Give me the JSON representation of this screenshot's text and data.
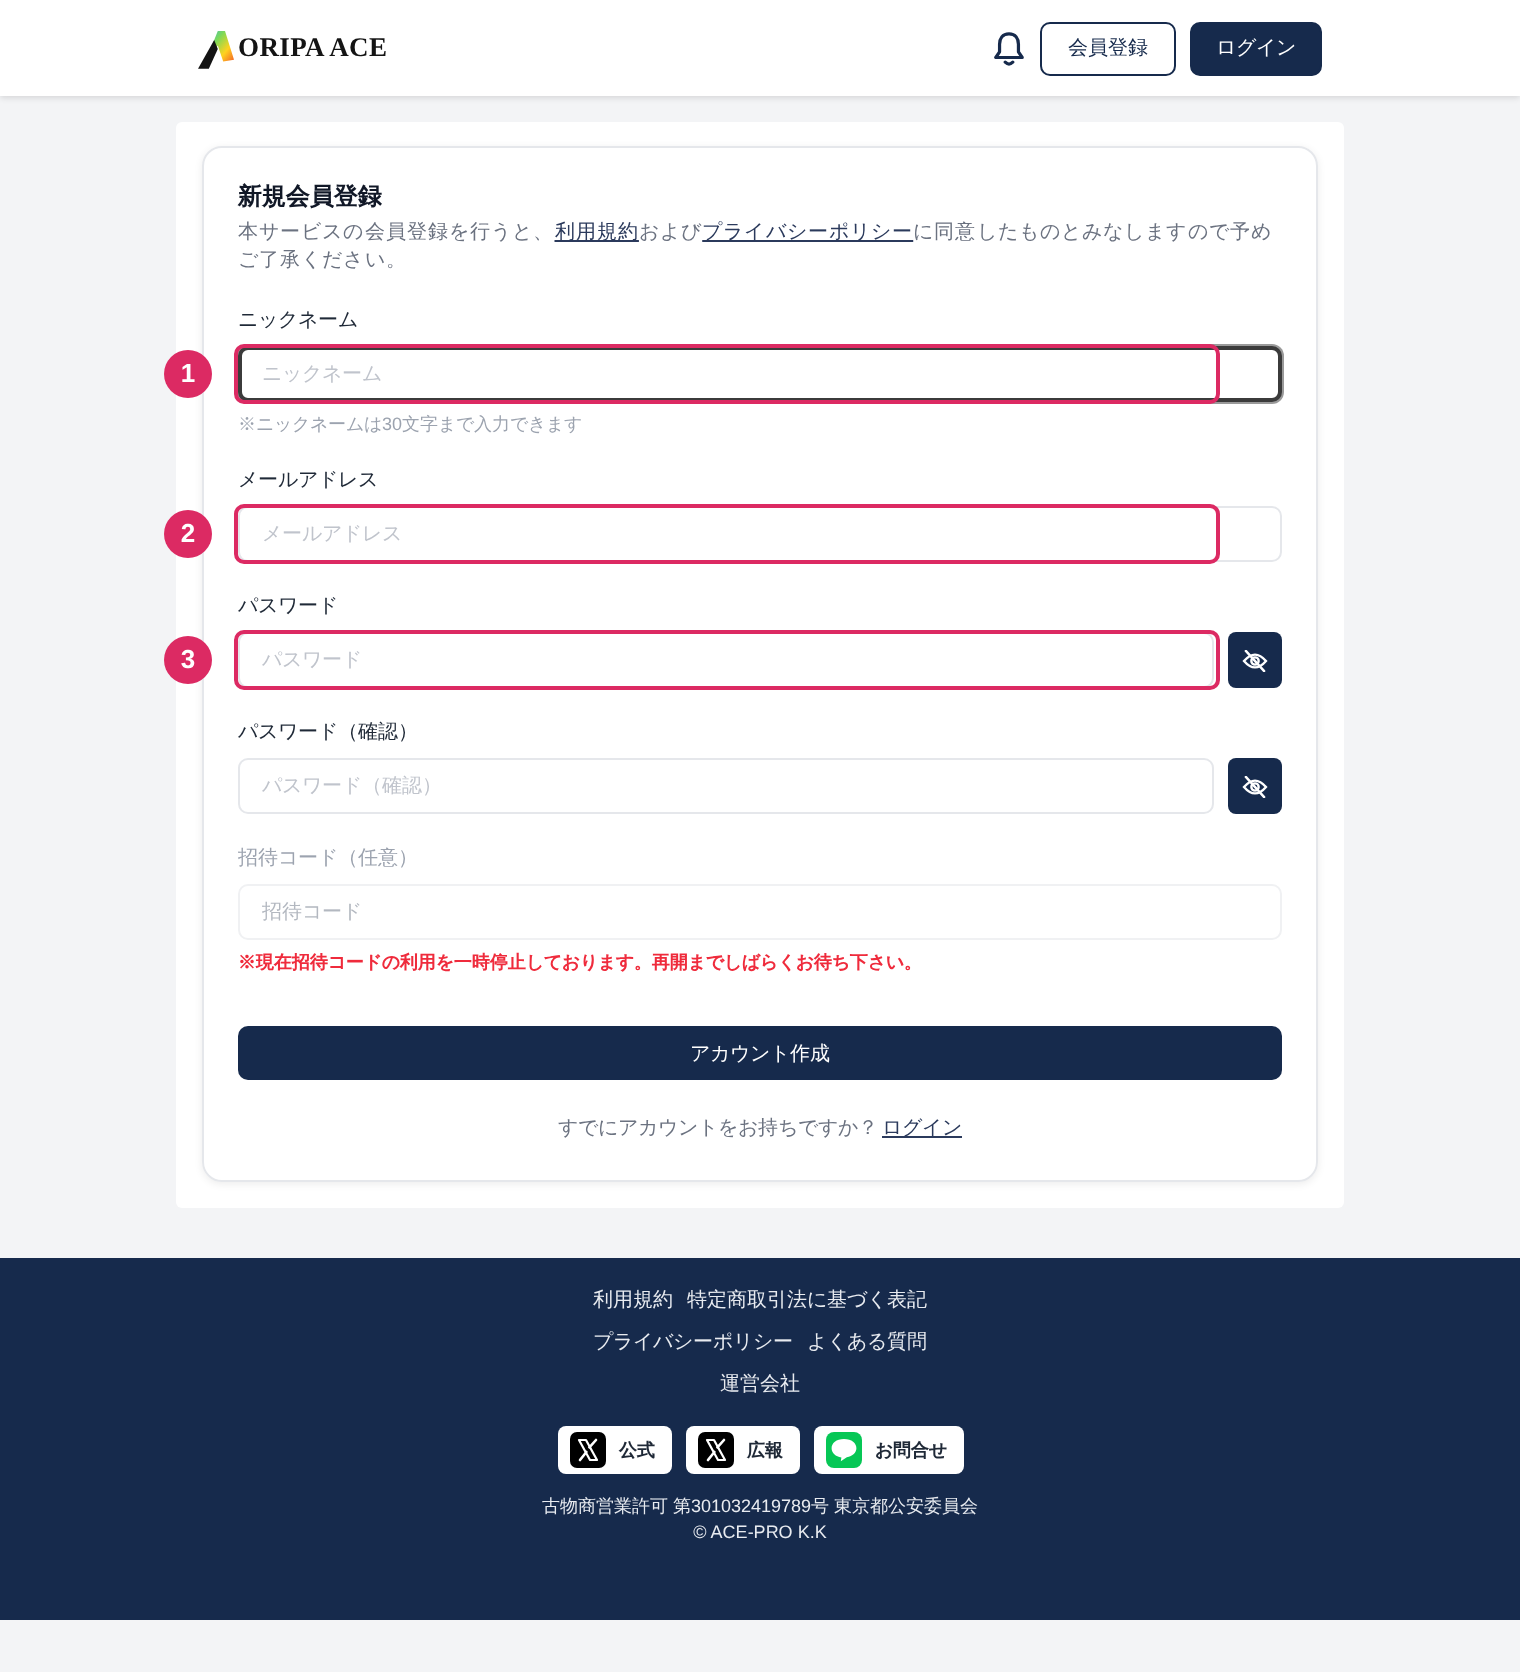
{
  "header": {
    "logo_text": "ORIPA ACE",
    "buttons": [
      {
        "label": "会員登録",
        "kind": "outline"
      },
      {
        "label": "ログイン",
        "kind": "filled"
      }
    ]
  },
  "form": {
    "title": "新規会員登録",
    "description": [
      {
        "kind": "text",
        "text": "本サービスの会員登録を行うと、"
      },
      {
        "kind": "link",
        "text": "利用規約"
      },
      {
        "kind": "text",
        "text": "および"
      },
      {
        "kind": "link",
        "text": "プライバシーポリシー"
      },
      {
        "kind": "text",
        "text": "に同意したものとみなしますので予めご了承ください。"
      }
    ],
    "fields": [
      {
        "kind": "text",
        "label": "ニックネーム",
        "placeholder": "ニックネーム",
        "hint": "※ニックネームは30文字まで入力できます",
        "focused": true,
        "disabled": false,
        "annotation": "1"
      },
      {
        "kind": "text",
        "label": "メールアドレス",
        "placeholder": "メールアドレス",
        "focused": false,
        "disabled": false,
        "annotation": "2"
      },
      {
        "kind": "password",
        "label": "パスワード",
        "placeholder": "パスワード",
        "focused": false,
        "disabled": false,
        "annotation": "3"
      },
      {
        "kind": "password",
        "label": "パスワード（確認）",
        "placeholder": "パスワード（確認）",
        "focused": false,
        "disabled": false
      },
      {
        "kind": "text",
        "label": "招待コード（任意）",
        "placeholder": "招待コード",
        "error": "※現在招待コードの利用を一時停止しております。再開までしばらくお待ち下さい。",
        "focused": false,
        "disabled": true
      }
    ],
    "submit": "アカウント作成",
    "login_prompt": {
      "text": "すでにアカウントをお持ちですか？",
      "link": "ログイン"
    }
  },
  "footer": {
    "link_rows": [
      [
        "利用規約",
        "特定商取引法に基づく表記"
      ],
      [
        "プライバシーポリシー",
        "よくある質問"
      ],
      [
        "運営会社"
      ]
    ],
    "social": [
      {
        "kind": "x",
        "label": "公式"
      },
      {
        "kind": "x",
        "label": "広報"
      },
      {
        "kind": "line",
        "label": "お問合せ"
      }
    ],
    "license": "古物商営業許可 第301032419789号 東京都公安委員会",
    "copyright": "© ACE-PRO K.K"
  }
}
